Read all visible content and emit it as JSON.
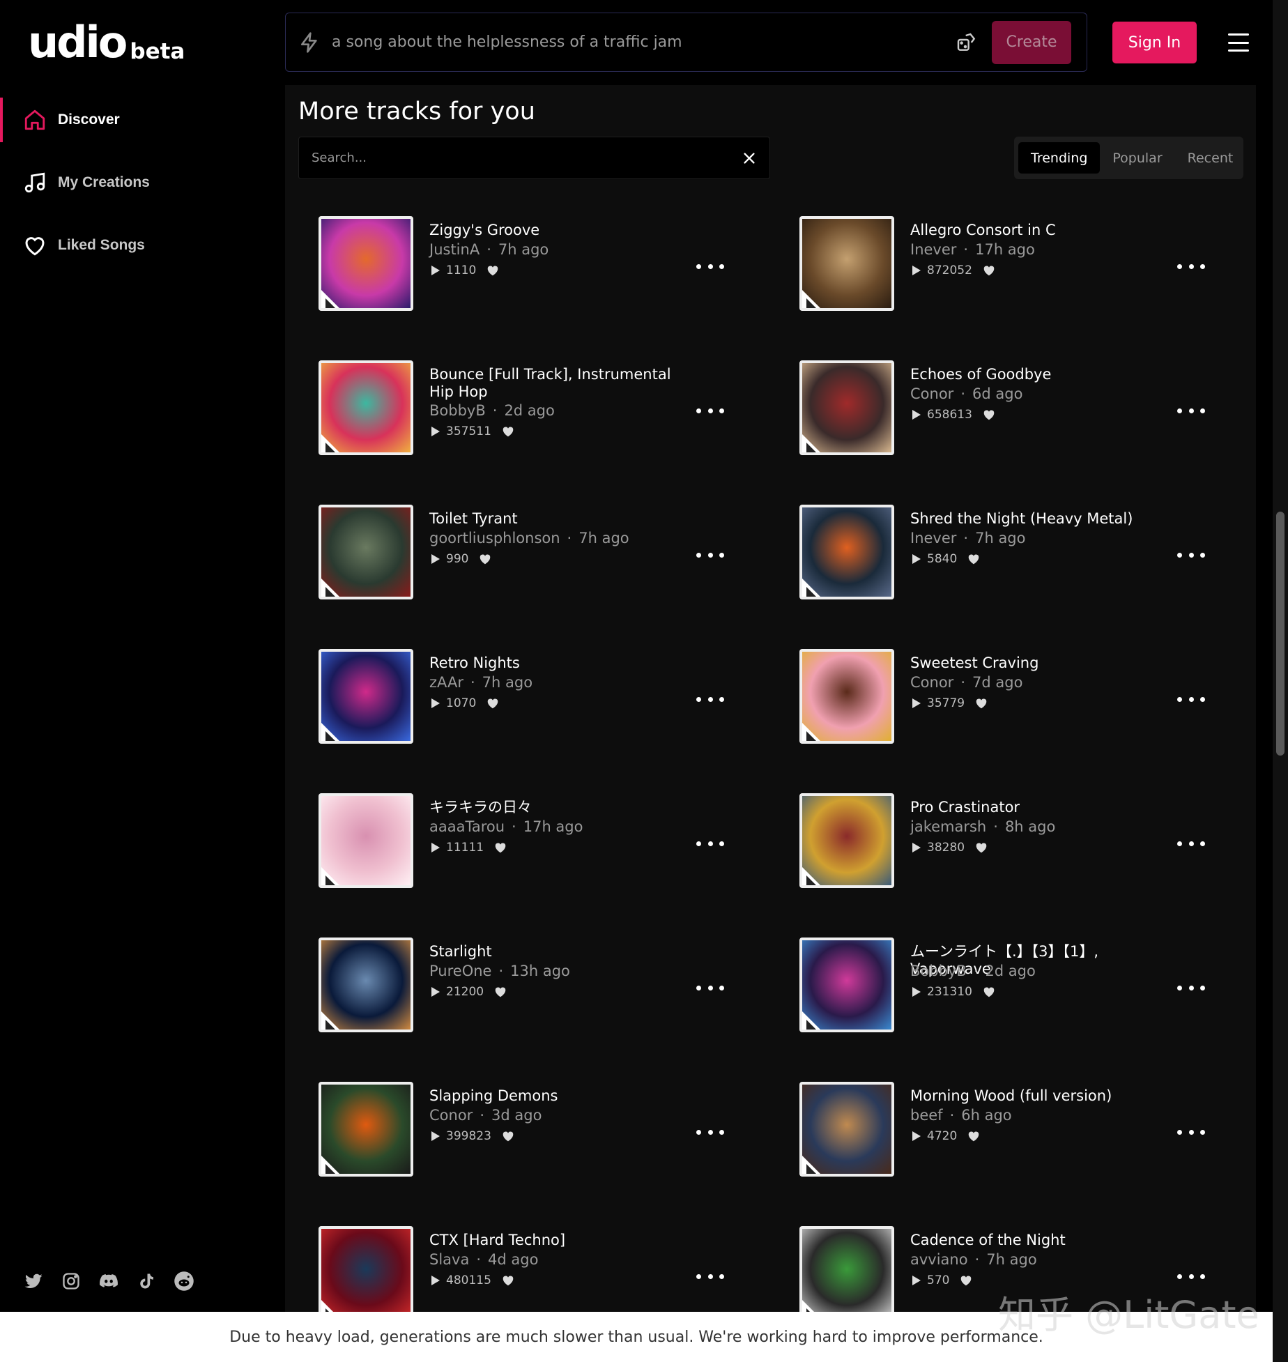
{
  "brand": {
    "logo": "udio",
    "badge": "beta",
    "accent": "#e5195e"
  },
  "nav": [
    {
      "label": "Discover",
      "icon": "home-icon",
      "active": true
    },
    {
      "label": "My Creations",
      "icon": "music-note-icon",
      "active": false
    },
    {
      "label": "Liked Songs",
      "icon": "heart-icon",
      "active": false
    }
  ],
  "socials": [
    "twitter-icon",
    "instagram-icon",
    "discord-icon",
    "tiktok-icon",
    "reddit-icon"
  ],
  "prompt": {
    "placeholder": "a song about the helplessness of a traffic jam",
    "create_label": "Create"
  },
  "header": {
    "signin_label": "Sign In"
  },
  "section": {
    "title": "More tracks for you",
    "search_placeholder": "Search...",
    "tabs": [
      {
        "label": "Trending",
        "active": true
      },
      {
        "label": "Popular",
        "active": false
      },
      {
        "label": "Recent",
        "active": false
      }
    ]
  },
  "tracks": [
    {
      "title": "Ziggy's Groove",
      "author": "JustinA",
      "age": "7h ago",
      "plays": "1110",
      "colors": [
        "#c83aa8",
        "#e46a2c",
        "#2a1a6a"
      ]
    },
    {
      "title": "Allegro Consort in C",
      "author": "Inever",
      "age": "17h ago",
      "plays": "872052",
      "colors": [
        "#6a4a2a",
        "#c4a070",
        "#2a1c10"
      ]
    },
    {
      "title": "Bounce [Full Track], Instrumental Hip Hop",
      "author": "BobbyB",
      "age": "2d ago",
      "plays": "357511",
      "colors": [
        "#d8325a",
        "#3cb8a0",
        "#f0b040"
      ]
    },
    {
      "title": "Echoes of Goodbye",
      "author": "Conor",
      "age": "6d ago",
      "plays": "658613",
      "colors": [
        "#3a2a2a",
        "#a02a2a",
        "#d8b890"
      ]
    },
    {
      "title": "Toilet Tyrant",
      "author": "goortliusphlonson",
      "age": "7h ago",
      "plays": "990",
      "colors": [
        "#2a3a30",
        "#6a7a60",
        "#8a1a1a"
      ]
    },
    {
      "title": "Shred the Night (Heavy Metal)",
      "author": "Inever",
      "age": "7h ago",
      "plays": "5840",
      "colors": [
        "#1a2a3a",
        "#e06020",
        "#5a6a8a"
      ]
    },
    {
      "title": "Retro Nights",
      "author": "zAAr",
      "age": "7h ago",
      "plays": "1070",
      "colors": [
        "#1a1a5a",
        "#d02a8a",
        "#3a6ae0"
      ]
    },
    {
      "title": "Sweetest Craving",
      "author": "Conor",
      "age": "7d ago",
      "plays": "35779",
      "colors": [
        "#f0a0b0",
        "#5a2a1a",
        "#e0b030"
      ]
    },
    {
      "title": "キラキラの日々",
      "author": "aaaaTarou",
      "age": "17h ago",
      "plays": "11111",
      "colors": [
        "#f0c0d0",
        "#d890b0",
        "#fff0f4"
      ]
    },
    {
      "title": "Pro Crastinator",
      "author": "jakemarsh",
      "age": "8h ago",
      "plays": "38280",
      "colors": [
        "#d0a030",
        "#8a2a2a",
        "#3a5a7a"
      ]
    },
    {
      "title": "Starlight",
      "author": "PureOne",
      "age": "13h ago",
      "plays": "21200",
      "colors": [
        "#0a1a3a",
        "#6a8ab0",
        "#d08a40"
      ]
    },
    {
      "title": "ムーンライト【.】【3】【1】, Vaporwave",
      "author": "BobbyB",
      "age": "2d ago",
      "plays": "231310",
      "colors": [
        "#2a1a4a",
        "#d03a9a",
        "#3a8ad0"
      ]
    },
    {
      "title": "Slapping Demons",
      "author": "Conor",
      "age": "3d ago",
      "plays": "399823",
      "colors": [
        "#2a4a2a",
        "#e05a10",
        "#1a1a1a"
      ]
    },
    {
      "title": "Morning Wood (full version)",
      "author": "beef",
      "age": "6h ago",
      "plays": "4720",
      "colors": [
        "#2a3a5a",
        "#c08a50",
        "#4a2a1a"
      ]
    },
    {
      "title": "CTX [Hard Techno]",
      "author": "Slava",
      "age": "4d ago",
      "plays": "480115",
      "colors": [
        "#6a0a1a",
        "#1a3a5a",
        "#d02a2a"
      ]
    },
    {
      "title": "Cadence of the Night",
      "author": "avviano",
      "age": "7h ago",
      "plays": "570",
      "colors": [
        "#2a2a2a",
        "#3a9a3a",
        "#d0d0d0"
      ]
    }
  ],
  "banner": "Due to heavy load, generations are much slower than usual. We're working hard to improve performance.",
  "watermark": "知乎 @LitGate"
}
